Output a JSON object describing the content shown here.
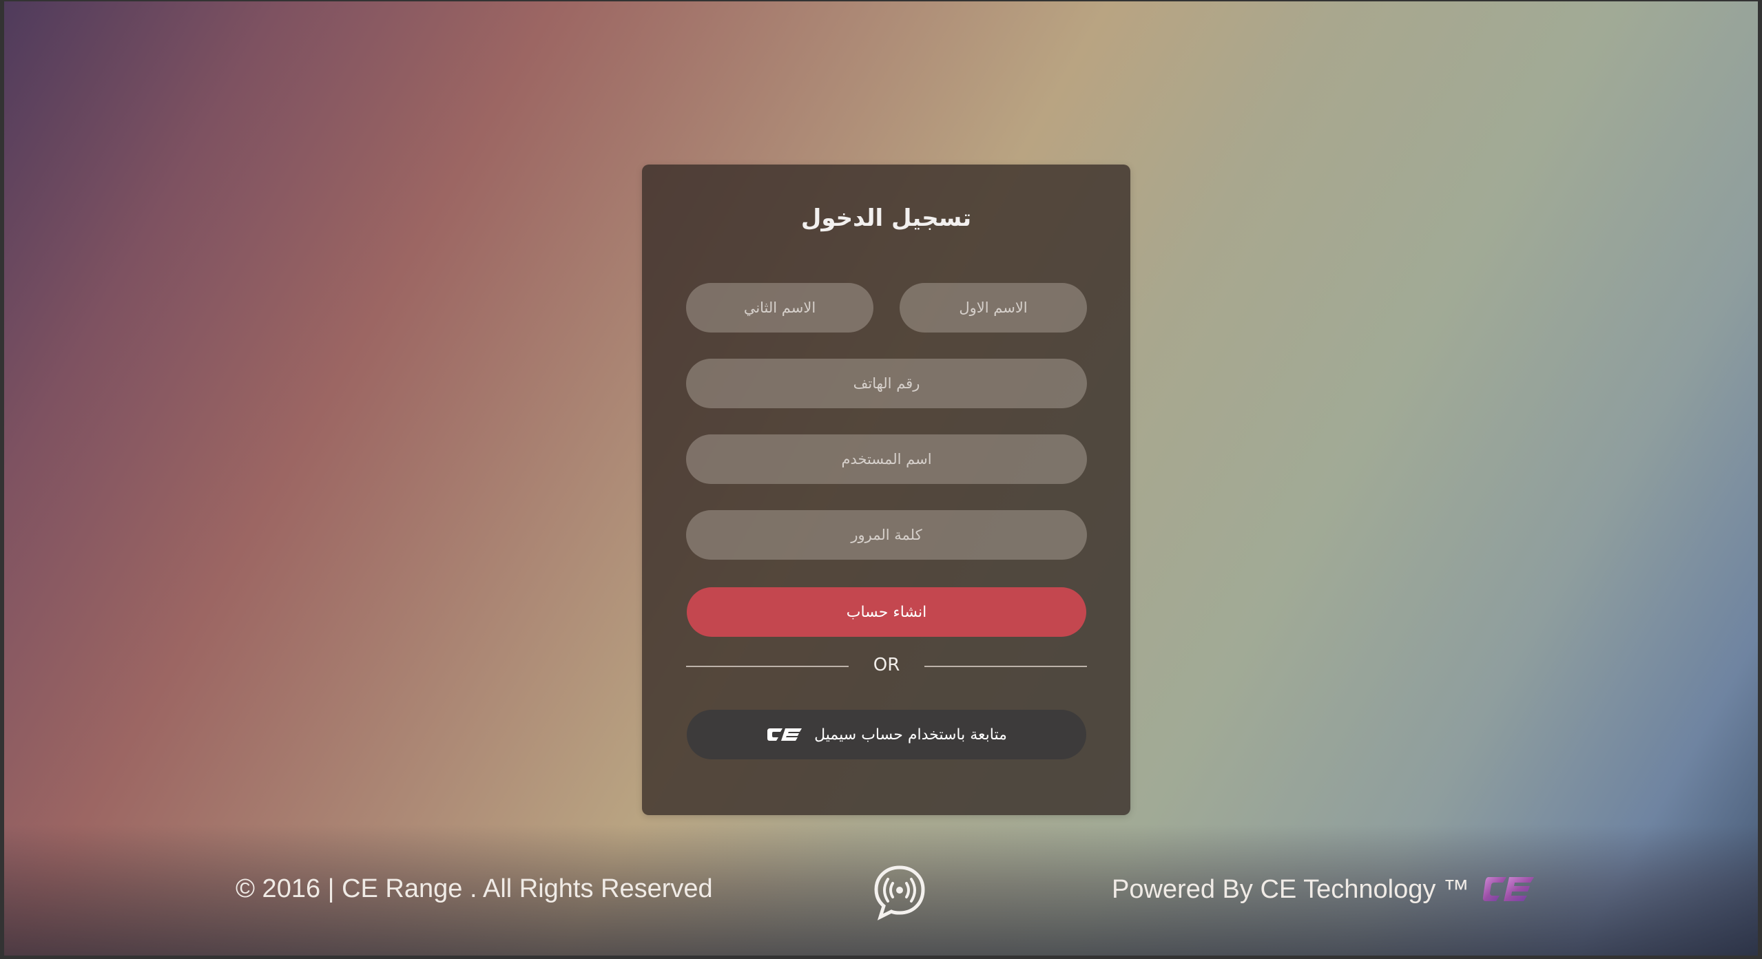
{
  "form": {
    "title": "تسجيل الدخول",
    "first_name_placeholder": "الاسم الاول",
    "last_name_placeholder": "الاسم الثاني",
    "phone_placeholder": "رقم الهاتف",
    "username_placeholder": "اسم المستخدم",
    "password_placeholder": "كلمة المرور",
    "create_account_label": "انشاء حساب",
    "divider_text": "OR",
    "cemail_button_label": "متابعة باستخدام حساب سيميل"
  },
  "footer": {
    "copyright": "© 2016 | CE Range . All Rights Reserved",
    "powered_by": "Powered By CE Technology ™",
    "center_icon": "broadcast-chat-icon",
    "brand_logo": "ce-logo"
  },
  "colors": {
    "accent_red": "#c4474f",
    "dark_button": "#3d3b3b"
  }
}
